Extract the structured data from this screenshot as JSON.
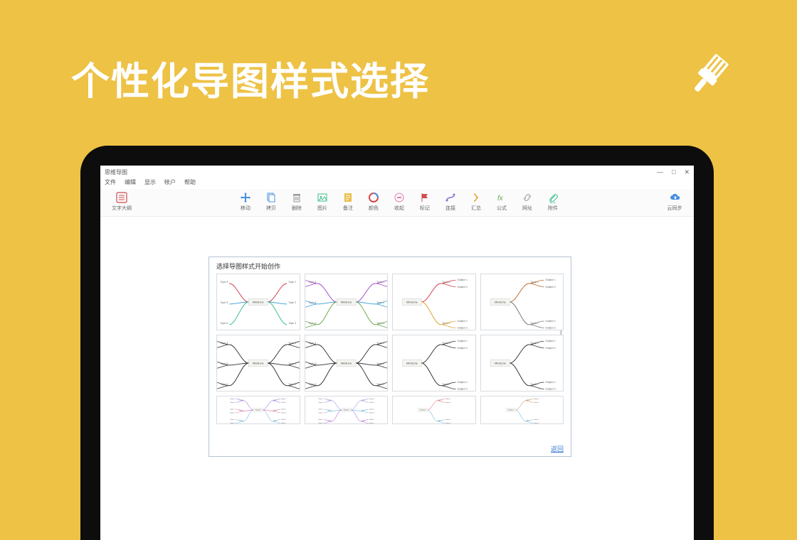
{
  "headline": "个性化导图样式选择",
  "app": {
    "window_title": "思维导图",
    "menus": [
      "文件",
      "编辑",
      "显示",
      "帐户",
      "帮助"
    ],
    "toolbar_left": {
      "outline": "文字大纲"
    },
    "toolbar_center": [
      {
        "id": "move",
        "label": "移动",
        "icon": "move-icon"
      },
      {
        "id": "copy",
        "label": "拷贝",
        "icon": "copy-icon"
      },
      {
        "id": "delete",
        "label": "删除",
        "icon": "trash-icon"
      },
      {
        "id": "image",
        "label": "图片",
        "icon": "image-icon"
      },
      {
        "id": "note",
        "label": "备注",
        "icon": "note-icon"
      },
      {
        "id": "color",
        "label": "颜色",
        "icon": "palette-icon"
      },
      {
        "id": "collapse",
        "label": "收起",
        "icon": "collapse-icon"
      },
      {
        "id": "mark",
        "label": "标记",
        "icon": "flag-icon"
      },
      {
        "id": "connect",
        "label": "连接",
        "icon": "connect-icon"
      },
      {
        "id": "summary",
        "label": "汇总",
        "icon": "summary-icon"
      },
      {
        "id": "formula",
        "label": "公式",
        "icon": "formula-icon"
      },
      {
        "id": "url",
        "label": "网址",
        "icon": "link-icon"
      },
      {
        "id": "attach",
        "label": "附件",
        "icon": "attach-icon"
      }
    ],
    "toolbar_right": {
      "sync": "云同步"
    }
  },
  "dialog": {
    "title": "选择导图样式开始创作",
    "back": "返回",
    "node_labels": {
      "center": "MindLine",
      "left": [
        "Topic 4",
        "Topic 5",
        "Topic 6"
      ],
      "right": [
        "Topic 1",
        "Topic 2",
        "Topic 3"
      ],
      "sub": [
        "Subject 1",
        "Subject 2",
        "Subject 3",
        "Subject 4"
      ]
    },
    "templates": [
      {
        "id": 0,
        "layout": "balanced",
        "palette": [
          "#d23a4a",
          "#3a9fd2",
          "#3bbf86"
        ],
        "depth": 1
      },
      {
        "id": 1,
        "layout": "balanced",
        "palette": [
          "#a04ac8",
          "#3a9fd2",
          "#6ba84f"
        ],
        "depth": 2
      },
      {
        "id": 2,
        "layout": "right",
        "palette": [
          "#d23a4a",
          "#e0a030",
          "#3a9fd2",
          "#2aa5b8"
        ],
        "depth": 2
      },
      {
        "id": 3,
        "layout": "right",
        "palette": [
          "#b36a2a",
          "#777777"
        ],
        "depth": 2
      },
      {
        "id": 4,
        "layout": "balanced",
        "palette": [
          "#333333"
        ],
        "depth": 2
      },
      {
        "id": 5,
        "layout": "balanced",
        "palette": [
          "#333333"
        ],
        "depth": 2
      },
      {
        "id": 6,
        "layout": "right",
        "palette": [
          "#333333"
        ],
        "depth": 2
      },
      {
        "id": 7,
        "layout": "right",
        "palette": [
          "#333333"
        ],
        "depth": 2
      },
      {
        "id": 8,
        "layout": "balanced",
        "palette": [
          "#7a3ad2",
          "#d23a8a",
          "#3a9fd2"
        ],
        "depth": 2
      },
      {
        "id": 9,
        "layout": "balanced",
        "palette": [
          "#6a6ad2",
          "#3a9fd2",
          "#9a3ad2"
        ],
        "depth": 2
      },
      {
        "id": 10,
        "layout": "right",
        "palette": [
          "#d23a4a",
          "#3a9fd2",
          "#3bbf86"
        ],
        "depth": 2
      },
      {
        "id": 11,
        "layout": "right",
        "palette": [
          "#b36a2a",
          "#3a9fd2",
          "#777777"
        ],
        "depth": 2
      }
    ]
  },
  "window_controls": {
    "minimize": "—",
    "maximize": "□",
    "close": "✕"
  }
}
